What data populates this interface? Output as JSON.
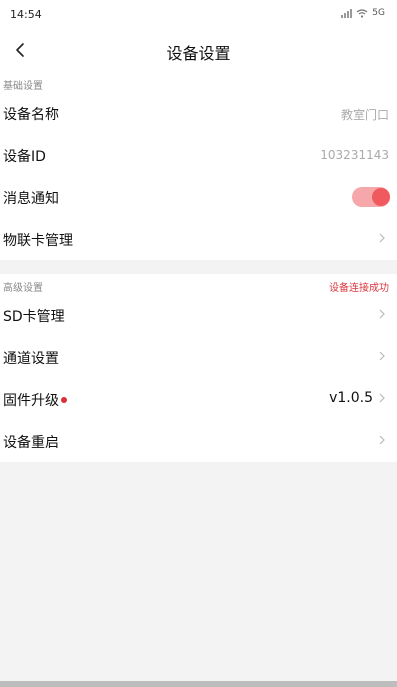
{
  "status_bar": {
    "time": "14:54",
    "indicator_text": "5G"
  },
  "header": {
    "title": "设备设置"
  },
  "basic": {
    "section_label": "基础设置",
    "device_name_label": "设备名称",
    "device_name_value": "教室门口",
    "device_id_label": "设备ID",
    "device_id_value": "103231143",
    "notify_label": "消息通知",
    "notify_enabled": true,
    "sim_label": "物联卡管理"
  },
  "advanced": {
    "section_label": "高级设置",
    "status_text": "设备连接成功",
    "sd_label": "SD卡管理",
    "channel_label": "通道设置",
    "firmware_label": "固件升级",
    "firmware_version": "v1.0.5",
    "reboot_label": "设备重启"
  },
  "colors": {
    "accent": "#f05a5e",
    "status_red": "#d9363e"
  },
  "icons": [
    "back-arrow-icon",
    "chevron-right-icon",
    "signal-icon",
    "wifi-icon"
  ]
}
